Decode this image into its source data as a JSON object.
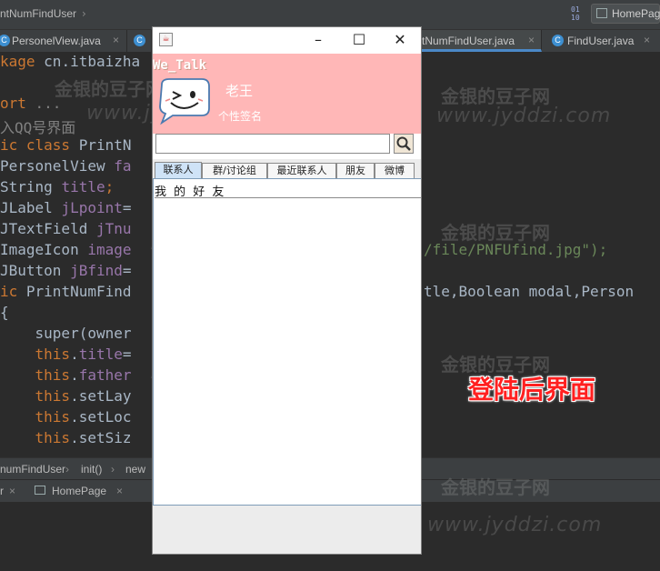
{
  "ide": {
    "breadcrumb_top": "ntNumFindUser",
    "homepage_button": "HomePage",
    "tabs": [
      {
        "label": "PersonelView.java",
        "icon": "C"
      },
      {
        "label": "C",
        "icon": ""
      },
      {
        "label": "tNumFindUser.java",
        "icon": ""
      },
      {
        "label": "FindUser.java",
        "icon": "C"
      }
    ],
    "code_lines": [
      {
        "p": [
          {
            "t": "kage ",
            "c": "kw"
          },
          {
            "t": "cn.itbaizha",
            "c": ""
          }
        ]
      },
      {
        "p": [
          {
            "t": "",
            "c": ""
          }
        ]
      },
      {
        "p": [
          {
            "t": "ort ",
            "c": "kw"
          },
          {
            "t": "...",
            "c": "cmt"
          }
        ]
      },
      {
        "p": [
          {
            "t": "入QQ号界面",
            "c": "cmt"
          }
        ]
      },
      {
        "p": [
          {
            "t": "ic class ",
            "c": "kw"
          },
          {
            "t": "PrintN",
            "c": ""
          }
        ]
      },
      {
        "p": [
          {
            "t": "PersonelView ",
            "c": ""
          },
          {
            "t": "fa",
            "c": "fld"
          }
        ]
      },
      {
        "p": [
          {
            "t": "String ",
            "c": ""
          },
          {
            "t": "title",
            "c": "fld"
          },
          {
            "t": ";",
            "c": "kw"
          }
        ]
      },
      {
        "p": [
          {
            "t": "JLabel ",
            "c": ""
          },
          {
            "t": "jLpoint",
            "c": "fld"
          },
          {
            "t": "=",
            "c": ""
          }
        ]
      },
      {
        "p": [
          {
            "t": "JTextField ",
            "c": ""
          },
          {
            "t": "jTnu",
            "c": "fld"
          }
        ]
      },
      {
        "p": [
          {
            "t": "ImageIcon ",
            "c": ""
          },
          {
            "t": "image",
            "c": "fld"
          }
        ]
      },
      {
        "p": [
          {
            "t": "JButton ",
            "c": ""
          },
          {
            "t": "jBfind",
            "c": "fld"
          },
          {
            "t": "=",
            "c": ""
          }
        ]
      },
      {
        "p": [
          {
            "t": "ic ",
            "c": "kw"
          },
          {
            "t": "PrintNumFind",
            "c": ""
          }
        ]
      },
      {
        "p": [
          {
            "t": "{",
            "c": ""
          }
        ]
      },
      {
        "p": [
          {
            "t": "    super(owner",
            "c": ""
          }
        ]
      },
      {
        "p": [
          {
            "t": "    this",
            "c": "kw"
          },
          {
            "t": ".",
            "c": ""
          },
          {
            "t": "title",
            "c": "fld"
          },
          {
            "t": "=",
            "c": ""
          }
        ]
      },
      {
        "p": [
          {
            "t": "    this",
            "c": "kw"
          },
          {
            "t": ".",
            "c": ""
          },
          {
            "t": "father",
            "c": "fld"
          }
        ]
      },
      {
        "p": [
          {
            "t": "    this",
            "c": "kw"
          },
          {
            "t": ".setLay",
            "c": ""
          }
        ]
      },
      {
        "p": [
          {
            "t": "    this",
            "c": "kw"
          },
          {
            "t": ".setLoc",
            "c": ""
          }
        ]
      },
      {
        "p": [
          {
            "t": "    this",
            "c": "kw"
          },
          {
            "t": ".setSiz",
            "c": ""
          }
        ]
      }
    ],
    "code_right_1": "/file/PNFUfind.jpg\");",
    "code_right_2": "tle,Boolean modal,Person",
    "bottom_crumbs": [
      "numFindUser",
      "init()",
      "new"
    ],
    "bottom_tab_1": "r",
    "bottom_tab_2": "HomePage",
    "watermark_cn": "金银的豆子网",
    "watermark_url": "www.jyddzi.com",
    "watermark_com": ".com",
    "overlay_caption": "登陆后界面"
  },
  "window": {
    "app_name": "We_Talk",
    "user_name": "老王",
    "signature": "个性签名",
    "search_value": "",
    "tabs": [
      "联系人",
      "群/讨论组",
      "最近联系人",
      "朋友",
      "微博"
    ],
    "selected_tab": "联系人",
    "friends_label": "我 的 好 友",
    "friends": []
  }
}
